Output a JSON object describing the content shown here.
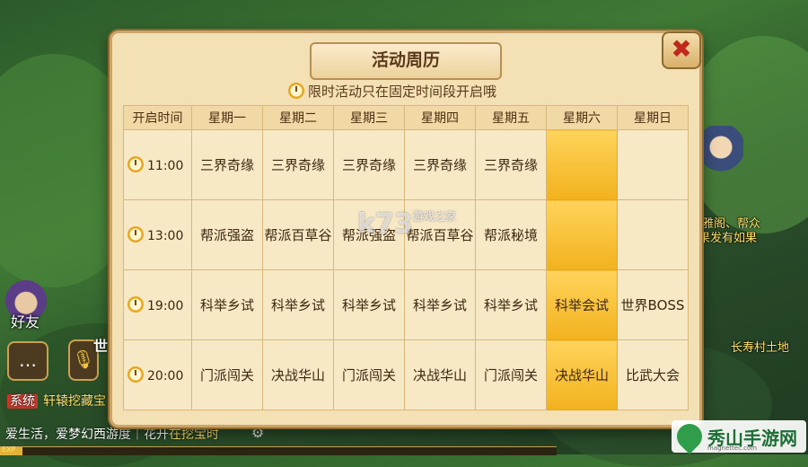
{
  "panel": {
    "title": "活动周历",
    "notice": "限时活动只在固定时间段开启哦",
    "close_label": "✖"
  },
  "table": {
    "headers": [
      "开启时间",
      "星期一",
      "星期二",
      "星期三",
      "星期四",
      "星期五",
      "星期六",
      "星期日"
    ],
    "rows": [
      {
        "time": "11:00",
        "cells": [
          "三界奇缘",
          "三界奇缘",
          "三界奇缘",
          "三界奇缘",
          "三界奇缘",
          "",
          ""
        ]
      },
      {
        "time": "13:00",
        "cells": [
          "帮派强盗",
          "帮派百草谷",
          "帮派强盗",
          "帮派百草谷",
          "帮派秘境",
          "",
          ""
        ]
      },
      {
        "time": "19:00",
        "cells": [
          "科举乡试",
          "科举乡试",
          "科举乡试",
          "科举乡试",
          "科举乡试",
          "科举会试",
          "世界BOSS"
        ]
      },
      {
        "time": "20:00",
        "cells": [
          "门派闯关",
          "决战华山",
          "门派闯关",
          "决战华山",
          "门派闯关",
          "决战华山",
          "比武大会"
        ]
      }
    ],
    "highlight_color": "#f5be2c"
  },
  "hud": {
    "friends_label": "好友",
    "world_label": "世",
    "chat_icon": "…"
  },
  "chat": {
    "system_tag": "系统",
    "line1": "轩辕挖藏宝",
    "line2_prefix": "爱生活，爱梦幻西游度｜花开",
    "line2_highlight": "在挖宝时"
  },
  "exp": {
    "label": "EXP",
    "progress": 0.04
  },
  "map_labels": {
    "npc1": "雅阁、帮众",
    "npc2": "果发有如果",
    "npc3": "长寿村土地"
  },
  "watermark": {
    "text": "k73",
    "sub": "游戏之家"
  },
  "site_logo": {
    "name": "秀山手游网",
    "domain": "magnettec.com"
  }
}
